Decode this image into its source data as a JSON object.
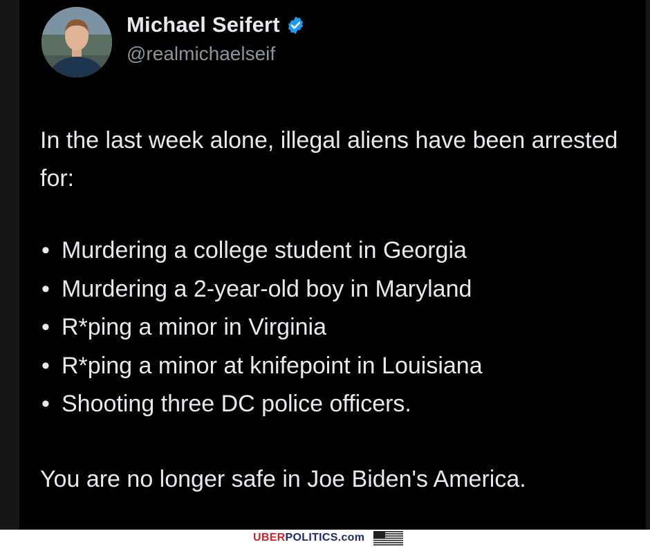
{
  "tweet": {
    "display_name": "Michael Seifert",
    "handle": "@realmichaelseif",
    "intro": "In the last week alone, illegal aliens have been arrested for:",
    "bullets": [
      "Murdering a college student in Georgia",
      "Murdering a 2-year-old boy in Maryland",
      "R*ping a minor in Virginia",
      "R*ping a minor at knifepoint in Louisiana",
      "Shooting three DC police officers."
    ],
    "closing": "You are no longer safe in Joe Biden's America."
  },
  "icons": {
    "verified": "verified-badge-icon",
    "flag": "us-flag-icon"
  },
  "footer": {
    "brand_part1": "UBER",
    "brand_part2": "POLITICS.com"
  },
  "colors": {
    "background": "#000000",
    "text": "#e7e9ea",
    "handle": "#8b949a",
    "verified": "#1d9bf0",
    "brand_red": "#d62027",
    "brand_navy": "#1d2a6b"
  }
}
